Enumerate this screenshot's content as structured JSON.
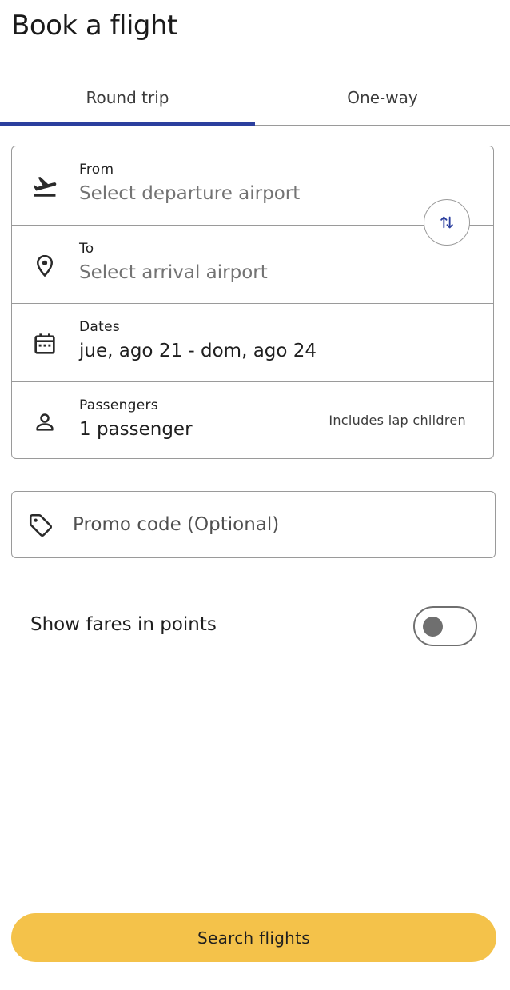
{
  "header": {
    "title": "Book a flight"
  },
  "tabs": [
    {
      "label": "Round trip",
      "active": true
    },
    {
      "label": "One-way",
      "active": false
    }
  ],
  "form": {
    "from": {
      "label": "From",
      "placeholder": "Select departure airport",
      "icon": "plane-takeoff-icon"
    },
    "to": {
      "label": "To",
      "placeholder": "Select arrival airport",
      "icon": "location-pin-icon"
    },
    "dates": {
      "label": "Dates",
      "value": "jue, ago 21 - dom, ago 24",
      "icon": "calendar-icon"
    },
    "passengers": {
      "label": "Passengers",
      "value": "1 passenger",
      "note": "Includes lap children",
      "icon": "person-icon"
    },
    "swap_icon": "swap-arrows-icon"
  },
  "promo": {
    "placeholder": "Promo code (Optional)",
    "value": "",
    "icon": "tag-icon"
  },
  "points_toggle": {
    "label": "Show fares in points",
    "enabled": false
  },
  "search_button": {
    "label": "Search flights"
  },
  "colors": {
    "accent": "#2b3f9e",
    "button": "#f4c24a",
    "border": "#9a9a9a",
    "placeholder": "#737373"
  }
}
